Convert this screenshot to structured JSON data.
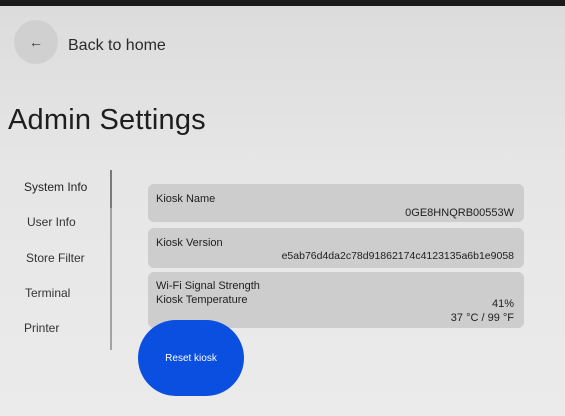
{
  "header": {
    "back_icon": "arrow-left-icon",
    "back_glyph": "←",
    "back_label": "Back to home"
  },
  "page": {
    "title": "Admin Settings"
  },
  "sidebar": {
    "items": [
      {
        "label": "System Info",
        "active": true
      },
      {
        "label": "User Info"
      },
      {
        "label": "Store Filter"
      },
      {
        "label": "Terminal"
      },
      {
        "label": "Printer"
      }
    ]
  },
  "system_info": {
    "kiosk_name_label": "Kiosk Name",
    "kiosk_name_value": "0GE8HNQRB00553W",
    "kiosk_version_label": "Kiosk Version",
    "kiosk_version_value": "e5ab76d4da2c78d91862174c4123135a6b1e9058",
    "wifi_label": "Wi-Fi Signal Strength",
    "wifi_value": "41%",
    "temp_label": "Kiosk Temperature",
    "temp_value": "37 °C / 99 °F"
  },
  "actions": {
    "reset_label": "Reset kiosk"
  },
  "colors": {
    "accent": "#0b4fe0",
    "card": "#cdcdcd",
    "background": "#e6e6e6"
  }
}
